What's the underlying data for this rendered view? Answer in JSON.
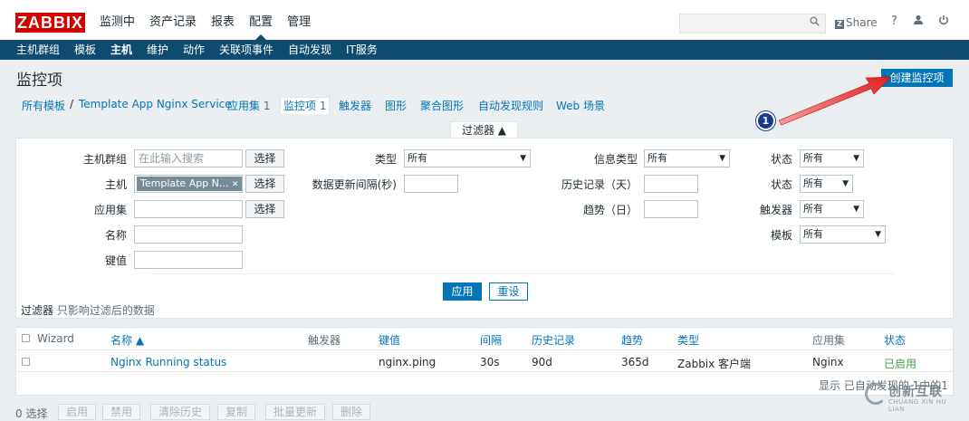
{
  "header": {
    "logo": "ZABBIX",
    "menu": [
      "监测中",
      "资产记录",
      "报表",
      "配置",
      "管理"
    ],
    "active_menu": "配置",
    "share_label": "Share",
    "share_box": "Z",
    "help_label": "?",
    "user_icon": "user-icon",
    "power_icon": "power-icon"
  },
  "submenu": {
    "items": [
      "主机群组",
      "模板",
      "主机",
      "维护",
      "动作",
      "关联项事件",
      "自动发现",
      "IT服务"
    ],
    "active": "主机"
  },
  "page": {
    "title": "监控项",
    "create_button": "创建监控项"
  },
  "breadcrumb": {
    "all_templates": "所有模板",
    "separator": "/",
    "template": "Template App Nginx Service",
    "tabs": [
      {
        "label": "应用集",
        "count": "1"
      },
      {
        "label": "监控项",
        "count": "1"
      },
      {
        "label": "触发器",
        "count": ""
      },
      {
        "label": "图形",
        "count": ""
      },
      {
        "label": "聚合图形",
        "count": ""
      },
      {
        "label": "自动发现规则",
        "count": ""
      },
      {
        "label": "Web 场景",
        "count": ""
      }
    ]
  },
  "filter": {
    "tab_label": "过滤器 ▲",
    "host_group_label": "主机群组",
    "host_group_placeholder": "在此输入搜索",
    "select_label": "选择",
    "host_label": "主机",
    "host_chip": "Template App N...",
    "chip_close": "✕",
    "app_label": "应用集",
    "name_label": "名称",
    "key_label": "键值",
    "type_label": "类型",
    "type_value": "所有",
    "interval_label": "数据更新间隔(秒)",
    "info_type_label": "信息类型",
    "info_type_value": "所有",
    "history_label": "历史记录（天）",
    "trends_label": "趋势（日）",
    "state_label": "状态",
    "state_value": "所有",
    "status_label": "状态",
    "status_value": "所有",
    "triggers_label": "触发器",
    "triggers_value": "所有",
    "template_label": "模板",
    "template_value": "所有",
    "apply_button": "应用",
    "reset_button": "重设",
    "note_strong": "过滤器",
    "note_muted": "只影响过滤后的数据"
  },
  "table": {
    "headers": {
      "wizard": "Wizard",
      "name": "名称 ▲",
      "triggers": "触发器",
      "key": "键值",
      "interval": "间隔",
      "history": "历史记录",
      "trends": "趋势",
      "type": "类型",
      "applications": "应用集",
      "status": "状态"
    },
    "rows": [
      {
        "name": "Nginx Running status",
        "triggers": "",
        "key": "nginx.ping",
        "interval": "30s",
        "history": "90d",
        "trends": "365d",
        "type": "Zabbix 客户端",
        "applications": "Nginx",
        "status": "已启用"
      }
    ],
    "footer": "显示 已自动发现的 1中的1"
  },
  "bottom": {
    "selected": "0 选择",
    "buttons": [
      "启用",
      "禁用",
      "清除历史",
      "复制",
      "批量更新",
      "删除"
    ]
  },
  "annotation": {
    "badge": "1",
    "arrow_color": "#e02020"
  },
  "watermark": {
    "text": "创新互联",
    "sub": "CHUANG XIN HU LIAN"
  }
}
